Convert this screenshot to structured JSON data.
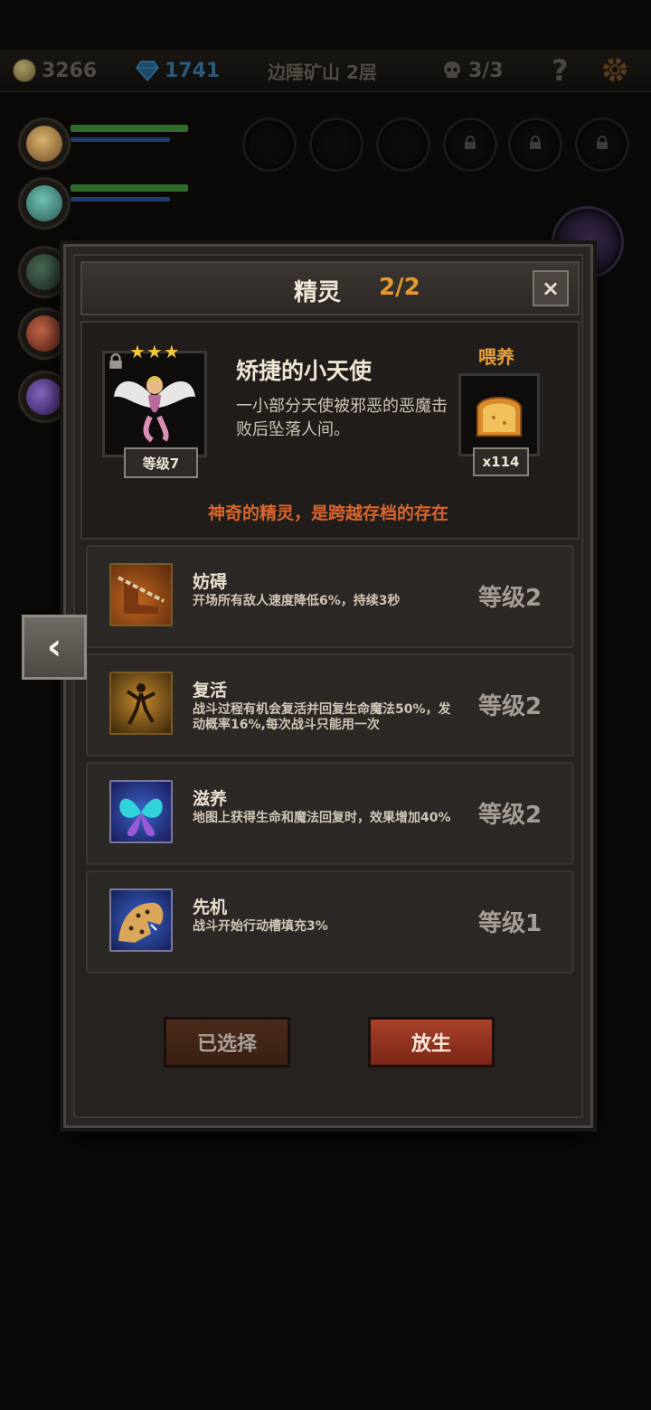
{
  "topbar": {
    "gold": "3266",
    "gems": "1741",
    "location": "边陲矿山 2层",
    "kills": "3/3",
    "help": "?"
  },
  "icons": {
    "coin": "coin-icon",
    "gem": "gem-icon",
    "skull": "skull-icon",
    "gear": "gear-icon",
    "lock": "lock-icon",
    "close": "close-icon",
    "back": "chevron-left-icon"
  },
  "dialog": {
    "title": "精灵",
    "count": "2/2",
    "close": "×",
    "spirit": {
      "stars": "★★★",
      "name": "矫捷的小天使",
      "description": "一小部分天使被邪恶的恶魔击败后坠落人间。",
      "level": "等级7"
    },
    "feed": {
      "label": "喂养",
      "count": "x114"
    },
    "tagline": "神奇的精灵，是跨越存档的存在",
    "skills": [
      {
        "name": "妨碍",
        "desc": "开场所有敌人速度降低6%，持续3秒",
        "level": "等级2"
      },
      {
        "name": "复活",
        "desc": "战斗过程有机会复活并回复生命魔法50%，发动概率16%,每次战斗只能用一次",
        "level": "等级2"
      },
      {
        "name": "滋养",
        "desc": "地图上获得生命和魔法回复时，效果增加40%",
        "level": "等级2"
      },
      {
        "name": "先机",
        "desc": "战斗开始行动槽填充3%",
        "level": "等级1"
      }
    ],
    "buttons": {
      "selected": "已选择",
      "release": "放生"
    }
  },
  "side_arrow": "‹",
  "colors": {
    "accent": "#e59a2b",
    "tagline": "#d8652e",
    "release_button": "#a8412a",
    "selected_button": "#4b2a1a"
  }
}
